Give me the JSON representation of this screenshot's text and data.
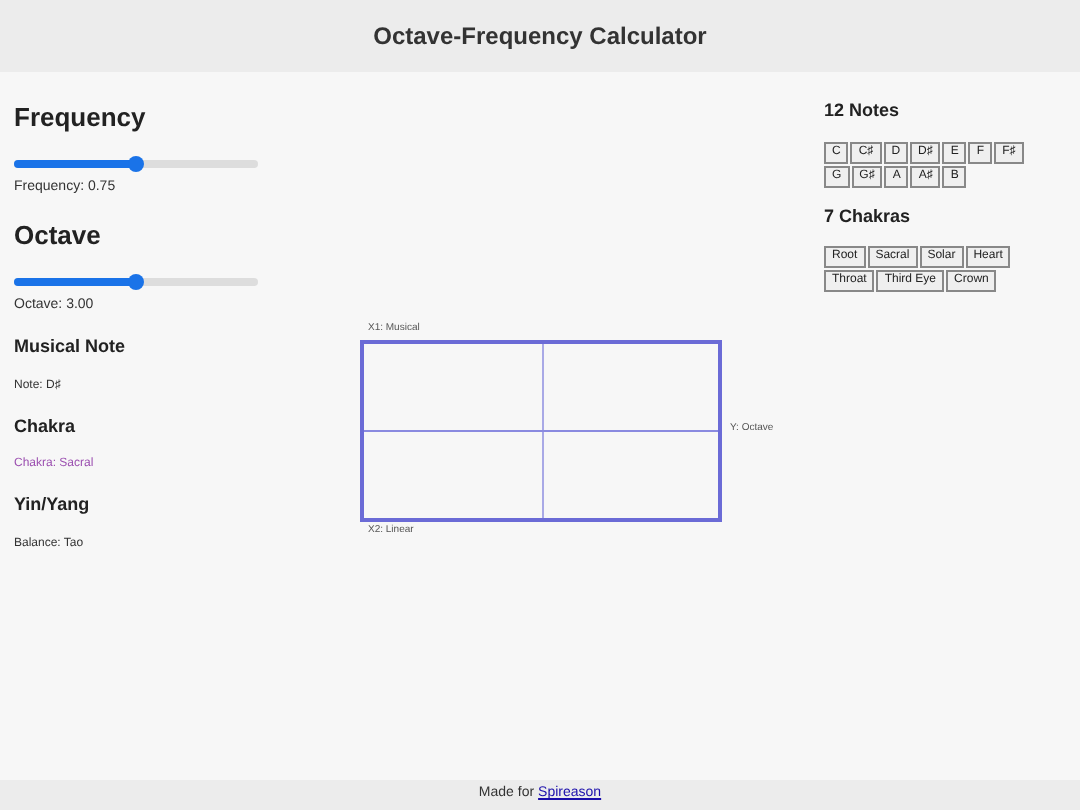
{
  "header": {
    "title": "Octave-Frequency Calculator"
  },
  "controls": [
    {
      "heading": "Frequency",
      "level": 0.5,
      "reading": "Frequency: 0.75"
    },
    {
      "heading": "Octave",
      "level": 0.5,
      "reading": "Octave: 3.00"
    }
  ],
  "info": [
    {
      "heading": "Musical Note",
      "text": "Note: D♯",
      "kind": "plain"
    },
    {
      "heading": "Chakra",
      "text": "Chakra: Sacral",
      "kind": "accent"
    },
    {
      "heading": "Yin/Yang",
      "text": "Balance: Tao",
      "kind": "plain"
    }
  ],
  "diagram": {
    "top_label": "X1: Musical",
    "right_label": "Y: Octave",
    "bottom_label": "X2: Linear"
  },
  "notes": {
    "heading": "12 Notes",
    "buttons": [
      "C",
      "C♯",
      "D",
      "D♯",
      "E",
      "F",
      "F♯",
      "G",
      "G♯",
      "A",
      "A♯",
      "B"
    ]
  },
  "chakras": {
    "heading": "7 Chakras",
    "buttons": [
      "Root",
      "Sacral",
      "Solar",
      "Heart",
      "Throat",
      "Third Eye",
      "Crown"
    ]
  },
  "footer": {
    "text": "Made for",
    "link": "Spireason"
  }
}
